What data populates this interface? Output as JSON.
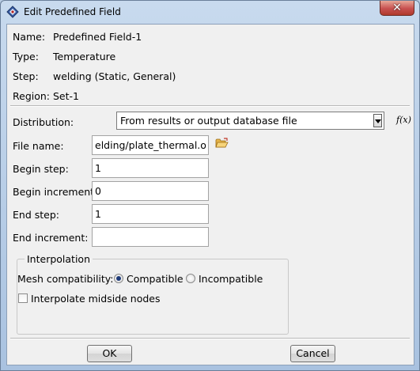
{
  "window": {
    "title": "Edit Predefined Field",
    "close_glyph": "✕"
  },
  "info": [
    {
      "label": "Name:",
      "value": "Predefined Field-1"
    },
    {
      "label": "Type:",
      "value": "Temperature"
    },
    {
      "label": "Step:",
      "value": "welding (Static, General)"
    },
    {
      "label": "Region:",
      "value": "Set-1"
    }
  ],
  "distribution": {
    "label": "Distribution:",
    "value": "From results or output database file",
    "fx": "f(x)"
  },
  "fields": {
    "file_name": {
      "label": "File name:",
      "value": "elding/plate_thermal.odb"
    },
    "begin_step": {
      "label": "Begin step:",
      "value": "1"
    },
    "begin_increment": {
      "label": "Begin increment:",
      "value": "0"
    },
    "end_step": {
      "label": "End step:",
      "value": "1"
    },
    "end_increment": {
      "label": "End increment:",
      "value": ""
    }
  },
  "interpolation": {
    "title": "Interpolation",
    "mesh_label": "Mesh compatibility:",
    "option_compatible": "Compatible",
    "option_incompatible": "Incompatible",
    "selected": "Compatible",
    "midside_label": "Interpolate midside nodes",
    "midside_checked": false
  },
  "buttons": {
    "ok": "OK",
    "cancel": "Cancel"
  },
  "icons": {
    "app": "abaqus-app-icon",
    "folder": "folder-open-icon",
    "close": "close-icon"
  }
}
